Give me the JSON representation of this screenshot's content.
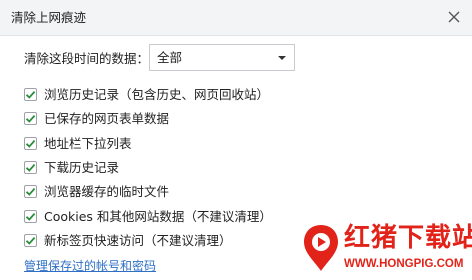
{
  "dialog": {
    "title": "清除上网痕迹",
    "close_icon": "close-icon"
  },
  "range": {
    "label": "清除这段时间的数据：",
    "selected": "全部"
  },
  "options": [
    {
      "label": "浏览历史记录（包含历史、网页回收站）",
      "checked": true
    },
    {
      "label": "已保存的网页表单数据",
      "checked": true
    },
    {
      "label": "地址栏下拉列表",
      "checked": true
    },
    {
      "label": "下载历史记录",
      "checked": true
    },
    {
      "label": "浏览器缓存的临时文件",
      "checked": true
    },
    {
      "label": "Cookies 和其他网站数据（不建议清理）",
      "checked": true
    },
    {
      "label": "新标签页快速访问（不建议清理）",
      "checked": true
    }
  ],
  "manage_link": "管理保存过的帐号和密码",
  "watermark": {
    "name": "红猪下载站",
    "url": "WWW.HONGPIG.COM"
  },
  "colors": {
    "check": "#2a8f3a",
    "link": "#2f6fc4",
    "watermark": "#e2231a",
    "titlebar": "#f3f4f6"
  }
}
